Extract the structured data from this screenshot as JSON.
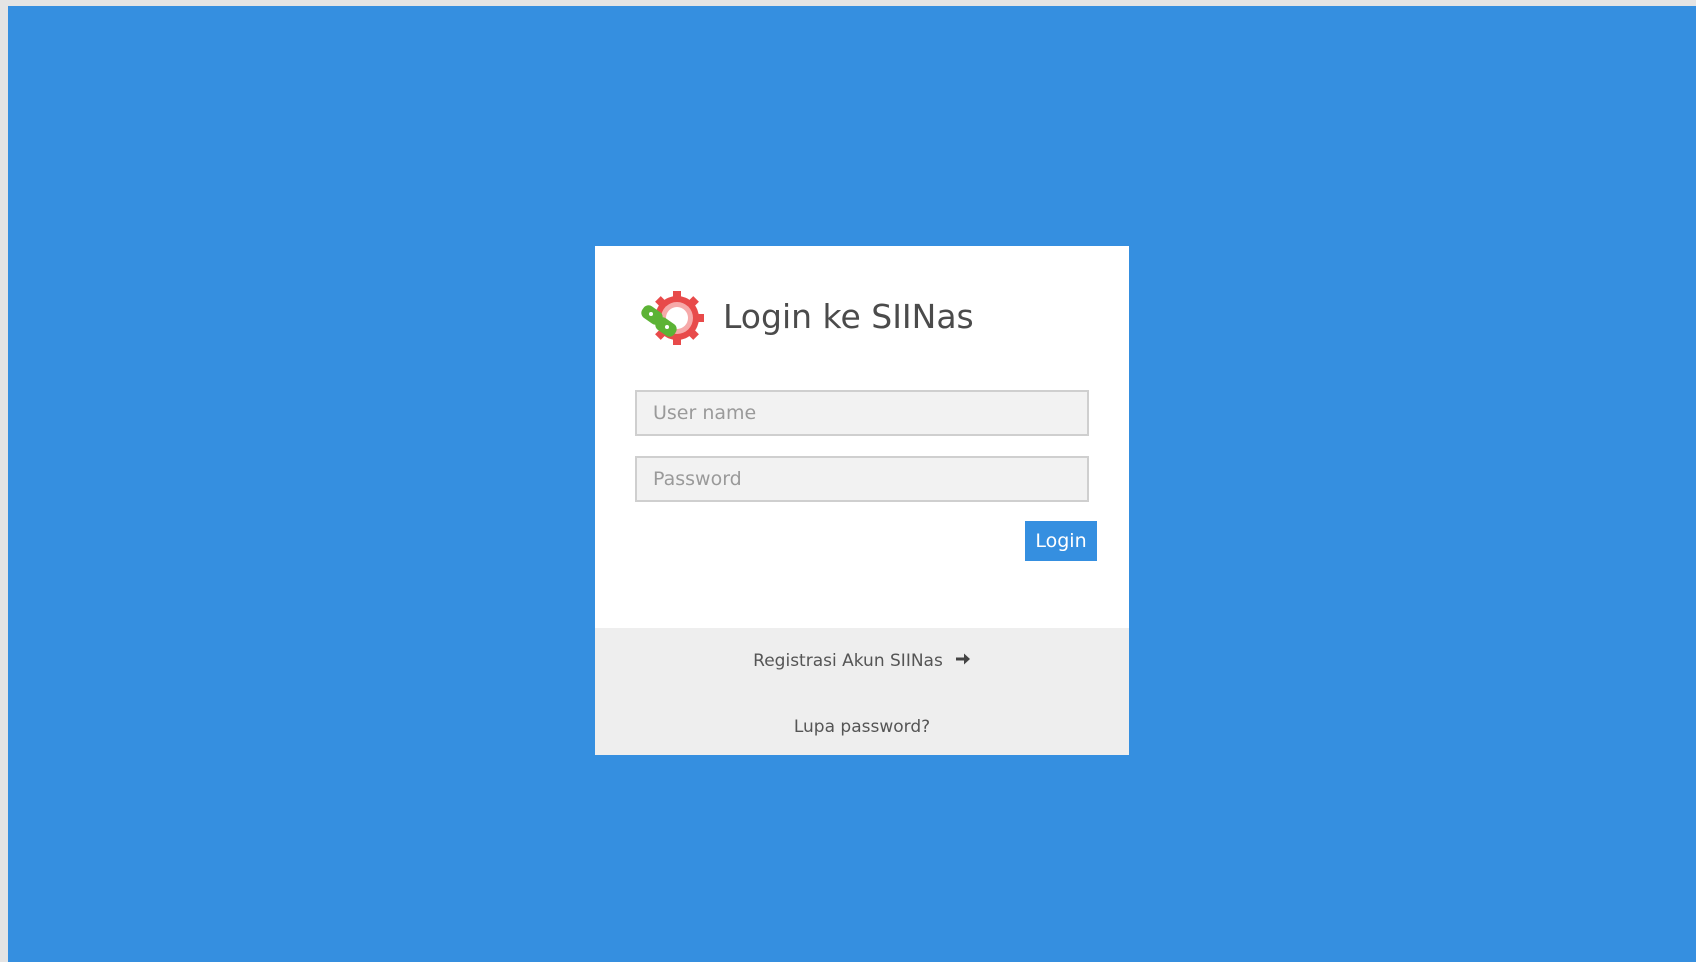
{
  "login": {
    "title": "Login ke SIINas",
    "username_placeholder": "User name",
    "password_placeholder": "Password",
    "login_button": "Login"
  },
  "footer": {
    "register_link": "Registrasi Akun SIINas",
    "forgot_link": "Lupa password?"
  },
  "icons": {
    "logo": "gear-logo-icon",
    "register_arrow": "arrow-right-icon"
  },
  "colors": {
    "background": "#358fe0",
    "accent": "#358fe0",
    "footer_bg": "#eeeeee"
  }
}
